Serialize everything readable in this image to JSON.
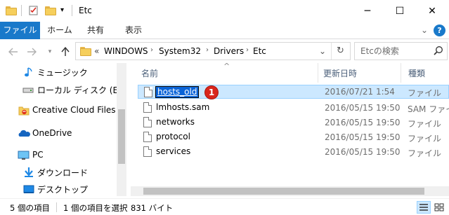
{
  "window": {
    "title": "Etc",
    "minimize_glyph": "─",
    "maximize_glyph": "☐",
    "close_glyph": "✕"
  },
  "ribbon": {
    "tabs": [
      {
        "label": "ファイル",
        "active": true
      },
      {
        "label": "ホーム"
      },
      {
        "label": "共有"
      },
      {
        "label": "表示"
      }
    ],
    "expand_glyph": "⌄",
    "help_glyph": "?"
  },
  "address": {
    "overflow_glyph": "«",
    "crumbs": [
      "WINDOWS",
      "System32",
      "Drivers",
      "Etc"
    ],
    "dropdown_glyph": "⌄",
    "refresh_glyph": "↻"
  },
  "search": {
    "placeholder": "Etcの検索",
    "icon": "search-icon"
  },
  "nav_pane": {
    "items": [
      {
        "label": "ミュージック",
        "icon": "music-icon"
      },
      {
        "label": "ローカル ディスク (E:)",
        "icon": "drive-icon"
      },
      {
        "label": "Creative Cloud Files",
        "icon": "creative-cloud-icon"
      },
      {
        "label": "OneDrive",
        "icon": "onedrive-icon"
      },
      {
        "label": "PC",
        "icon": "pc-icon"
      },
      {
        "label": "ダウンロード",
        "icon": "download-icon"
      },
      {
        "label": "デスクトップ",
        "icon": "desktop-icon"
      }
    ]
  },
  "file_list": {
    "columns": [
      "名前",
      "更新日時",
      "種類"
    ],
    "sort_glyph": "^",
    "rows": [
      {
        "name": "hosts_old",
        "modified": "2016/07/21 1:54",
        "type": "ファイル",
        "selected": true,
        "renaming": true
      },
      {
        "name": "lmhosts.sam",
        "modified": "2016/05/15 19:50",
        "type": "SAM ファイル"
      },
      {
        "name": "networks",
        "modified": "2016/05/15 19:50",
        "type": "ファイル"
      },
      {
        "name": "protocol",
        "modified": "2016/05/15 19:50",
        "type": "ファイル"
      },
      {
        "name": "services",
        "modified": "2016/05/15 19:50",
        "type": "ファイル"
      }
    ],
    "callout_number": "1"
  },
  "status": {
    "item_count": "5 個の項目",
    "selection": "1 個の項目を選択",
    "size": "831 バイト"
  },
  "colors": {
    "accent": "#1979ca",
    "selection_bg": "#cce8ff",
    "callout": "#d9261c"
  }
}
